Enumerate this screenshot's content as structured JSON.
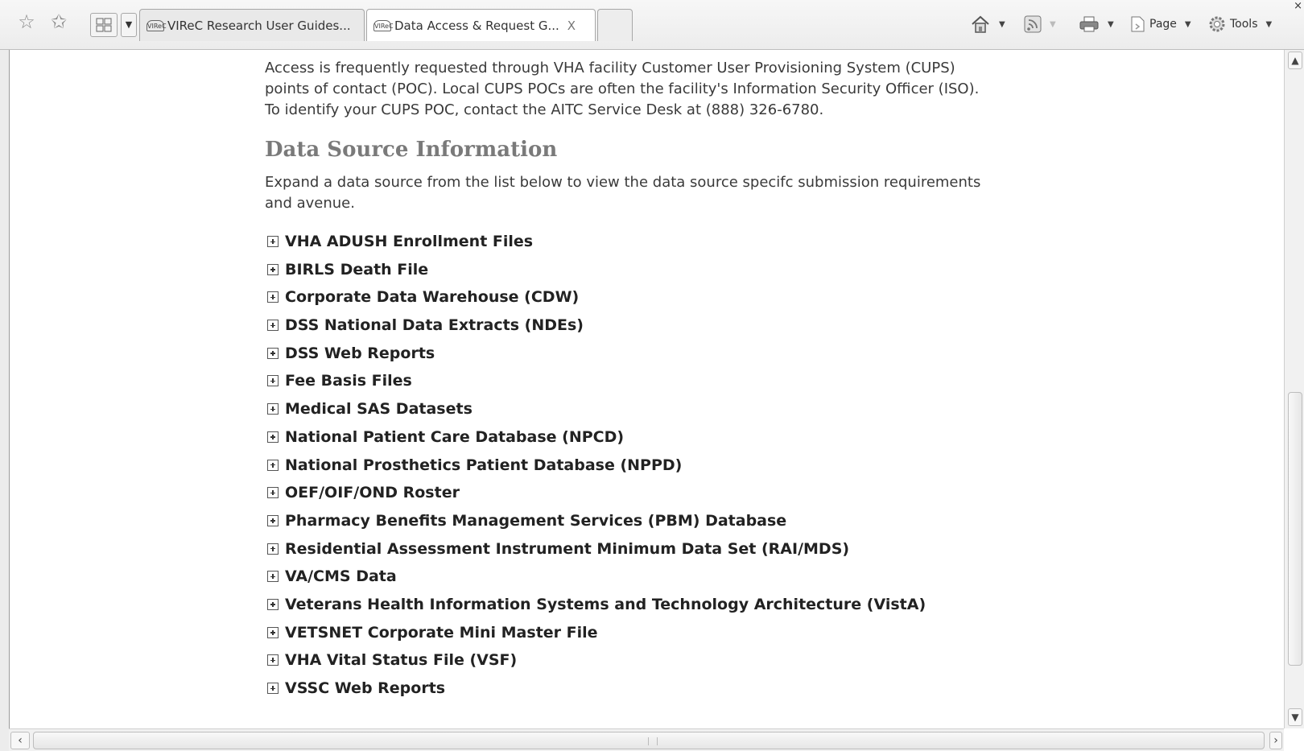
{
  "toolbar": {
    "tabs": [
      {
        "icon": "VIReC",
        "label": "VIReC Research User Guides..."
      },
      {
        "icon": "VIReC",
        "label": "Data Access & Request G...",
        "close": "X"
      }
    ],
    "commands": {
      "page_label": "Page",
      "tools_label": "Tools"
    },
    "window_close": "×"
  },
  "content": {
    "intro": "Access is frequently requested through VHA facility Customer User Provisioning System (CUPS) points of contact (POC). Local CUPS POCs are often the facility's Information Security Officer (ISO). To identify your CUPS POC, contact the AITC Service Desk at (888) 326-6780.",
    "heading": "Data Source Information",
    "instructions": "Expand a data source from the list below to view the data source specifc submission requirements and avenue.",
    "sources": [
      "VHA ADUSH Enrollment Files",
      "BIRLS Death File",
      "Corporate Data Warehouse (CDW)",
      "DSS National Data Extracts (NDEs)",
      "DSS Web Reports",
      "Fee Basis Files",
      "Medical SAS Datasets",
      "National Patient Care Database (NPCD)",
      "National Prosthetics Patient Database (NPPD)",
      "OEF/OIF/OND Roster",
      "Pharmacy Benefits Management Services (PBM) Database",
      "Residential Assessment Instrument Minimum Data Set (RAI/MDS)",
      "VA/CMS Data",
      "Veterans Health Information Systems and Technology Architecture (VistA)",
      "VETSNET Corporate Mini Master File",
      "VHA Vital Status File (VSF)",
      "VSSC Web Reports"
    ]
  }
}
